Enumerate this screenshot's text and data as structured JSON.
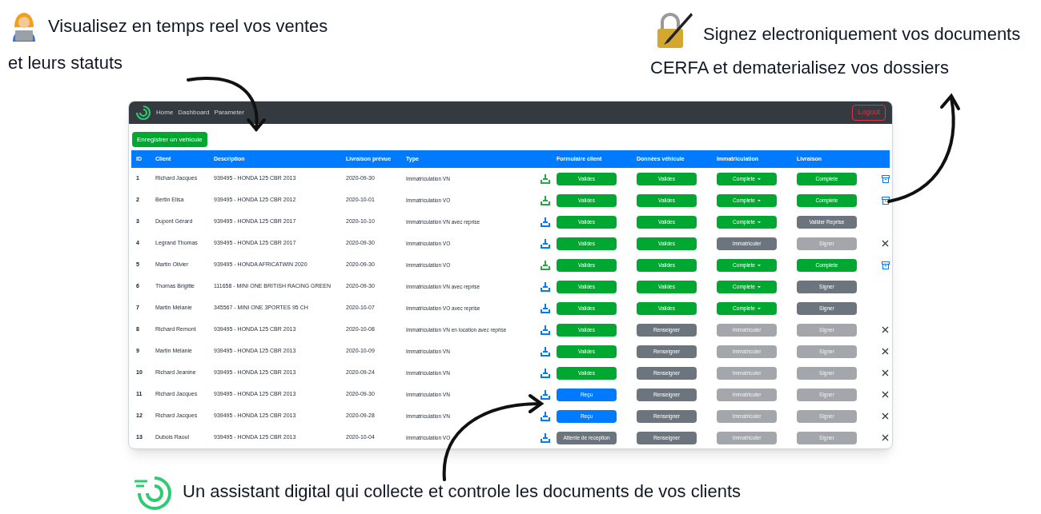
{
  "annotations": [
    {
      "lines": [
        "Visualisez en temps reel vos ventes",
        "et leurs statuts"
      ]
    },
    {
      "lines": [
        "Signez electroniquement vos documents",
        "CERFA et dematerialisez vos dossiers"
      ]
    },
    {
      "lines": [
        "Un assistant digital qui collecte et controle les documents de vos clients"
      ]
    }
  ],
  "navbar": {
    "links": [
      "Home",
      "Dashboard",
      "Parameter"
    ],
    "logout": "Logout"
  },
  "register_button": "Enregistrer un vehicule",
  "table": {
    "columns": [
      "ID",
      "Client",
      "Description",
      "Livraison prévue",
      "Type",
      "",
      "Formulaire client",
      "Données véhicule",
      "Immatriculation",
      "Livraison"
    ],
    "rows": [
      {
        "id": "1",
        "client": "Richard Jacques",
        "description": "939495 - HONDA 125 CBR 2013",
        "delivery": "2020-09-30",
        "type": "Immatriculation VN",
        "download": {
          "color": "#28a745"
        },
        "steps": [
          {
            "label": "Valides",
            "kind": "success",
            "dropdown": false
          },
          {
            "label": "Valides",
            "kind": "success",
            "dropdown": false
          },
          {
            "label": "Complete",
            "kind": "success",
            "dropdown": true
          },
          {
            "label": "Complete",
            "kind": "success",
            "dropdown": false
          }
        ],
        "action": {
          "kind": "archive"
        }
      },
      {
        "id": "2",
        "client": "Bertin Elisa",
        "description": "939495 - HONDA 125 CBR 2012",
        "delivery": "2020-10-01",
        "type": "Immatriculation VO",
        "download": {
          "color": "#28a745"
        },
        "steps": [
          {
            "label": "Valides",
            "kind": "success",
            "dropdown": false
          },
          {
            "label": "Valides",
            "kind": "success",
            "dropdown": false
          },
          {
            "label": "Complete",
            "kind": "success",
            "dropdown": true
          },
          {
            "label": "Complete",
            "kind": "success",
            "dropdown": false
          }
        ],
        "action": {
          "kind": "archive"
        }
      },
      {
        "id": "3",
        "client": "Dupont Gérard",
        "description": "939495 - HONDA 125 CBR 2017",
        "delivery": "2020-10-10",
        "type": "Immatriculation VN avec reprise",
        "download": {
          "color": "#007bff"
        },
        "steps": [
          {
            "label": "Valides",
            "kind": "success",
            "dropdown": false
          },
          {
            "label": "Valides",
            "kind": "success",
            "dropdown": false
          },
          {
            "label": "Complete",
            "kind": "success",
            "dropdown": true
          },
          {
            "label": "Valider Reprise",
            "kind": "secondary",
            "dropdown": false
          }
        ]
      },
      {
        "id": "4",
        "client": "Legrand Thomas",
        "description": "939495 - HONDA 125 CBR 2017",
        "delivery": "2020-09-30",
        "type": "Immatriculation VO",
        "download": {
          "color": "#007bff"
        },
        "steps": [
          {
            "label": "Valides",
            "kind": "success",
            "dropdown": false
          },
          {
            "label": "Valides",
            "kind": "success",
            "dropdown": false
          },
          {
            "label": "Immatriculer",
            "kind": "secondary",
            "dropdown": false
          },
          {
            "label": "Signer",
            "kind": "disabled",
            "dropdown": false
          }
        ],
        "action": {
          "kind": "delete"
        }
      },
      {
        "id": "5",
        "client": "Martin Olivier",
        "description": "939495 - HONDA AFRICATWIN 2020",
        "delivery": "2020-09-30",
        "type": "Immatriculation VO",
        "download": {
          "color": "#28a745"
        },
        "steps": [
          {
            "label": "Valides",
            "kind": "success",
            "dropdown": false
          },
          {
            "label": "Valides",
            "kind": "success",
            "dropdown": false
          },
          {
            "label": "Complete",
            "kind": "success",
            "dropdown": true
          },
          {
            "label": "Complete",
            "kind": "success",
            "dropdown": false
          }
        ],
        "action": {
          "kind": "archive"
        }
      },
      {
        "id": "6",
        "client": "Thomas Brigitte",
        "description": "111658 - MINI ONE BRITISH RACING GREEN",
        "delivery": "2020-09-30",
        "type": "Immatriculation VN avec reprise",
        "download": {
          "color": "#007bff"
        },
        "steps": [
          {
            "label": "Valides",
            "kind": "success",
            "dropdown": false
          },
          {
            "label": "Valides",
            "kind": "success",
            "dropdown": false
          },
          {
            "label": "Complete",
            "kind": "success",
            "dropdown": true
          },
          {
            "label": "Signer",
            "kind": "secondary",
            "dropdown": false
          }
        ]
      },
      {
        "id": "7",
        "client": "Martin Mélanie",
        "description": "345567 - MINI ONE 3PORTES 95 CH",
        "delivery": "2020-10-07",
        "type": "Immatriculation VO avec reprise",
        "download": {
          "color": "#007bff"
        },
        "steps": [
          {
            "label": "Valides",
            "kind": "success",
            "dropdown": false
          },
          {
            "label": "Valides",
            "kind": "success",
            "dropdown": false
          },
          {
            "label": "Complete",
            "kind": "success",
            "dropdown": true
          },
          {
            "label": "Signer",
            "kind": "secondary",
            "dropdown": false
          }
        ]
      },
      {
        "id": "8",
        "client": "Richard Remont",
        "description": "939495 - HONDA 125 CBR 2013",
        "delivery": "2020-10-08",
        "type": "Immatriculation VN en location avec reprise",
        "download": {
          "color": "#007bff"
        },
        "steps": [
          {
            "label": "Valides",
            "kind": "success",
            "dropdown": false
          },
          {
            "label": "Renseigner",
            "kind": "secondary",
            "dropdown": false
          },
          {
            "label": "Immatriculer",
            "kind": "disabled",
            "dropdown": false
          },
          {
            "label": "Signer",
            "kind": "disabled",
            "dropdown": false
          }
        ],
        "action": {
          "kind": "delete"
        }
      },
      {
        "id": "9",
        "client": "Martin Mélanie",
        "description": "939495 - HONDA 125 CBR 2013",
        "delivery": "2020-10-09",
        "type": "Immatriculation VN",
        "download": {
          "color": "#007bff"
        },
        "steps": [
          {
            "label": "Valides",
            "kind": "success",
            "dropdown": false
          },
          {
            "label": "Renseigner",
            "kind": "secondary",
            "dropdown": false
          },
          {
            "label": "Immatriculer",
            "kind": "disabled",
            "dropdown": false
          },
          {
            "label": "Signer",
            "kind": "disabled",
            "dropdown": false
          }
        ],
        "action": {
          "kind": "delete"
        }
      },
      {
        "id": "10",
        "client": "Richard Jeanine",
        "description": "939495 - HONDA 125 CBR 2013",
        "delivery": "2020-09-24",
        "type": "Immatriculation VN",
        "download": {
          "color": "#007bff"
        },
        "steps": [
          {
            "label": "Valides",
            "kind": "success",
            "dropdown": false
          },
          {
            "label": "Renseigner",
            "kind": "secondary",
            "dropdown": false
          },
          {
            "label": "Immatriculer",
            "kind": "disabled",
            "dropdown": false
          },
          {
            "label": "Signer",
            "kind": "disabled",
            "dropdown": false
          }
        ],
        "action": {
          "kind": "delete"
        }
      },
      {
        "id": "11",
        "client": "Richard Jacques",
        "description": "939495 - HONDA 125 CBR 2013",
        "delivery": "2020-09-30",
        "type": "Immatriculation VN",
        "download": {
          "color": "#007bff"
        },
        "steps": [
          {
            "label": "Reçu",
            "kind": "primary",
            "dropdown": false
          },
          {
            "label": "Renseigner",
            "kind": "secondary",
            "dropdown": false
          },
          {
            "label": "Immatriculer",
            "kind": "disabled",
            "dropdown": false
          },
          {
            "label": "Signer",
            "kind": "disabled",
            "dropdown": false
          }
        ],
        "action": {
          "kind": "delete"
        }
      },
      {
        "id": "12",
        "client": "Richard Jacques",
        "description": "939495 - HONDA 125 CBR 2013",
        "delivery": "2020-09-28",
        "type": "Immatriculation VN",
        "download": {
          "color": "#007bff"
        },
        "steps": [
          {
            "label": "Reçu",
            "kind": "primary",
            "dropdown": false
          },
          {
            "label": "Renseigner",
            "kind": "secondary",
            "dropdown": false
          },
          {
            "label": "Immatriculer",
            "kind": "disabled",
            "dropdown": false
          },
          {
            "label": "Signer",
            "kind": "disabled",
            "dropdown": false
          }
        ],
        "action": {
          "kind": "delete"
        }
      },
      {
        "id": "13",
        "client": "Dubois Raoul",
        "description": "939495 - HONDA 125 CBR 2013",
        "delivery": "2020-10-04",
        "type": "Immatriculation VO",
        "download": {
          "color": "#007bff"
        },
        "steps": [
          {
            "label": "Attente de reception",
            "kind": "secondary",
            "dropdown": false
          },
          {
            "label": "Renseigner",
            "kind": "secondary",
            "dropdown": false
          },
          {
            "label": "Immatriculer",
            "kind": "disabled",
            "dropdown": false
          },
          {
            "label": "Signer",
            "kind": "disabled",
            "dropdown": false
          }
        ],
        "action": {
          "kind": "delete"
        }
      }
    ]
  }
}
